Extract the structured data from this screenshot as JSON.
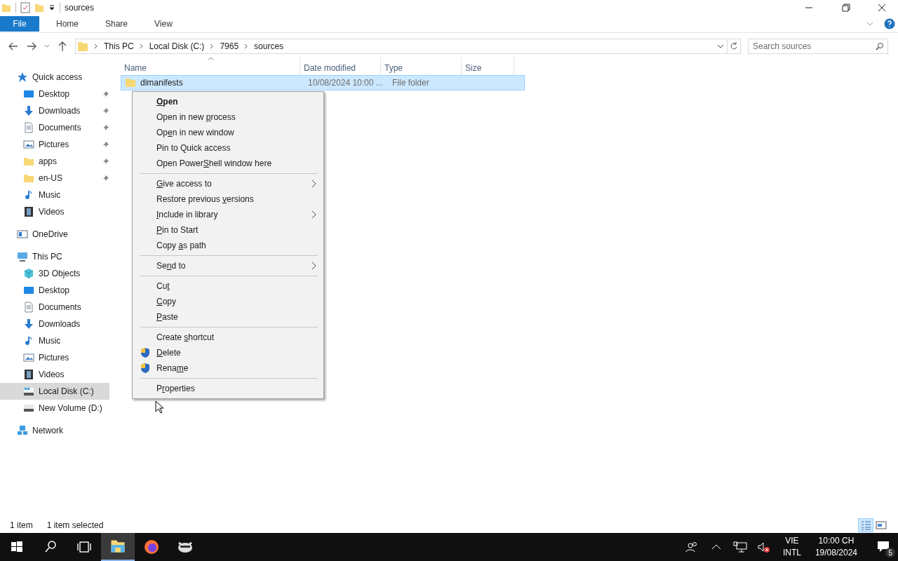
{
  "title_bar": {
    "title": "sources"
  },
  "ribbon": {
    "tabs": [
      {
        "label": "File",
        "kind": "file"
      },
      {
        "label": "Home",
        "kind": "tab"
      },
      {
        "label": "Share",
        "kind": "tab"
      },
      {
        "label": "View",
        "kind": "tab"
      }
    ]
  },
  "address_bar": {
    "crumbs": [
      "This PC",
      "Local Disk (C:)",
      "7965",
      "sources"
    ]
  },
  "search": {
    "placeholder": "Search sources"
  },
  "navigation": [
    {
      "label": "Quick access",
      "kind": "star",
      "selected": false,
      "children": [
        {
          "label": "Desktop",
          "kind": "desktop",
          "pinned": true,
          "selected": false
        },
        {
          "label": "Downloads",
          "kind": "downloads",
          "pinned": true,
          "selected": false
        },
        {
          "label": "Documents",
          "kind": "documents",
          "pinned": true,
          "selected": false
        },
        {
          "label": "Pictures",
          "kind": "pictures",
          "pinned": true,
          "selected": false
        },
        {
          "label": "apps",
          "kind": "folder",
          "pinned": true,
          "selected": false
        },
        {
          "label": "en-US",
          "kind": "folder",
          "pinned": true,
          "selected": false
        },
        {
          "label": "Music",
          "kind": "music",
          "pinned": false,
          "selected": false
        },
        {
          "label": "Videos",
          "kind": "videos",
          "pinned": false,
          "selected": false
        }
      ]
    },
    {
      "label": "OneDrive",
      "kind": "onedrive",
      "selected": false
    },
    {
      "label": "This PC",
      "kind": "pc",
      "selected": false,
      "children": [
        {
          "label": "3D Objects",
          "kind": "cube",
          "pinned": false,
          "selected": false
        },
        {
          "label": "Desktop",
          "kind": "desktop",
          "pinned": false,
          "selected": false
        },
        {
          "label": "Documents",
          "kind": "documents",
          "pinned": false,
          "selected": false
        },
        {
          "label": "Downloads",
          "kind": "downloads",
          "pinned": false,
          "selected": false
        },
        {
          "label": "Music",
          "kind": "music",
          "pinned": false,
          "selected": false
        },
        {
          "label": "Pictures",
          "kind": "pictures",
          "pinned": false,
          "selected": false
        },
        {
          "label": "Videos",
          "kind": "videos",
          "pinned": false,
          "selected": false
        },
        {
          "label": "Local Disk (C:)",
          "kind": "systemdrive",
          "pinned": false,
          "selected": true
        },
        {
          "label": "New Volume (D:)",
          "kind": "drive",
          "pinned": false,
          "selected": false
        }
      ]
    },
    {
      "label": "Network",
      "kind": "network",
      "selected": false
    }
  ],
  "file_list": {
    "columns": [
      {
        "label": "Name",
        "sorted": true
      },
      {
        "label": "Date modified",
        "sorted": false
      },
      {
        "label": "Type",
        "sorted": false
      },
      {
        "label": "Size",
        "sorted": false
      }
    ],
    "rows": [
      {
        "name": "dlmanifests",
        "date_modified": "10/08/2024 10:00 ...",
        "type": "File folder",
        "selected": true
      }
    ]
  },
  "context_menu": {
    "groups": [
      [
        {
          "parts": [
            {
              "text": "O",
              "underlined": true
            },
            {
              "text": "pen",
              "underlined": false
            }
          ],
          "default": true,
          "submenu": false,
          "shield": false
        },
        {
          "parts": [
            {
              "text": "Open in new ",
              "underlined": false
            },
            {
              "text": "p",
              "underlined": true
            },
            {
              "text": "rocess",
              "underlined": false
            }
          ],
          "default": false,
          "submenu": false,
          "shield": false
        },
        {
          "parts": [
            {
              "text": "Op",
              "underlined": false
            },
            {
              "text": "e",
              "underlined": true
            },
            {
              "text": "n in new window",
              "underlined": false
            }
          ],
          "default": false,
          "submenu": false,
          "shield": false
        },
        {
          "parts": [
            {
              "text": "Pin to Quick access",
              "underlined": false
            }
          ],
          "default": false,
          "submenu": false,
          "shield": false
        },
        {
          "parts": [
            {
              "text": "Open Power",
              "underlined": false
            },
            {
              "text": "S",
              "underlined": true
            },
            {
              "text": "hell window here",
              "underlined": false
            }
          ],
          "default": false,
          "submenu": false,
          "shield": false
        }
      ],
      [
        {
          "parts": [
            {
              "text": "G",
              "underlined": true
            },
            {
              "text": "ive access to",
              "underlined": false
            }
          ],
          "default": false,
          "submenu": true,
          "shield": false
        },
        {
          "parts": [
            {
              "text": "Restore previous ",
              "underlined": false
            },
            {
              "text": "v",
              "underlined": true
            },
            {
              "text": "ersions",
              "underlined": false
            }
          ],
          "default": false,
          "submenu": false,
          "shield": false
        },
        {
          "parts": [
            {
              "text": "I",
              "underlined": true
            },
            {
              "text": "nclude in library",
              "underlined": false
            }
          ],
          "default": false,
          "submenu": true,
          "shield": false
        },
        {
          "parts": [
            {
              "text": "P",
              "underlined": true
            },
            {
              "text": "in to Start",
              "underlined": false
            }
          ],
          "default": false,
          "submenu": false,
          "shield": false
        },
        {
          "parts": [
            {
              "text": "Copy ",
              "underlined": false
            },
            {
              "text": "a",
              "underlined": true
            },
            {
              "text": "s path",
              "underlined": false
            }
          ],
          "default": false,
          "submenu": false,
          "shield": false
        }
      ],
      [
        {
          "parts": [
            {
              "text": "Se",
              "underlined": false
            },
            {
              "text": "n",
              "underlined": true
            },
            {
              "text": "d to",
              "underlined": false
            }
          ],
          "default": false,
          "submenu": true,
          "shield": false
        }
      ],
      [
        {
          "parts": [
            {
              "text": "Cu",
              "underlined": false
            },
            {
              "text": "t",
              "underlined": true
            }
          ],
          "default": false,
          "submenu": false,
          "shield": false
        },
        {
          "parts": [
            {
              "text": "C",
              "underlined": true
            },
            {
              "text": "opy",
              "underlined": false
            }
          ],
          "default": false,
          "submenu": false,
          "shield": false
        },
        {
          "parts": [
            {
              "text": "P",
              "underlined": true
            },
            {
              "text": "aste",
              "underlined": false
            }
          ],
          "default": false,
          "submenu": false,
          "shield": false
        }
      ],
      [
        {
          "parts": [
            {
              "text": "Create ",
              "underlined": false
            },
            {
              "text": "s",
              "underlined": true
            },
            {
              "text": "hortcut",
              "underlined": false
            }
          ],
          "default": false,
          "submenu": false,
          "shield": false
        },
        {
          "parts": [
            {
              "text": "D",
              "underlined": true
            },
            {
              "text": "elete",
              "underlined": false
            }
          ],
          "default": false,
          "submenu": false,
          "shield": true
        },
        {
          "parts": [
            {
              "text": "Rena",
              "underlined": false
            },
            {
              "text": "m",
              "underlined": true
            },
            {
              "text": "e",
              "underlined": false
            }
          ],
          "default": false,
          "submenu": false,
          "shield": true
        }
      ],
      [
        {
          "parts": [
            {
              "text": "P",
              "underlined": false
            },
            {
              "text": "r",
              "underlined": true
            },
            {
              "text": "operties",
              "underlined": false
            }
          ],
          "default": false,
          "submenu": false,
          "shield": false
        }
      ]
    ]
  },
  "status_bar": {
    "item_count": "1 item",
    "selection": "1 item selected",
    "views": [
      {
        "kind": "details",
        "selected": true
      },
      {
        "kind": "large_icons",
        "selected": false
      }
    ]
  },
  "taskbar": {
    "apps": [
      {
        "kind": "explorer",
        "selected": true
      },
      {
        "kind": "firefox",
        "selected": false
      },
      {
        "kind": "raccoon",
        "selected": false
      }
    ],
    "tray": {
      "language": "VIE",
      "layout": "INTL",
      "time": "10:00 CH",
      "date": "19/08/2024",
      "notifications": "5"
    }
  }
}
